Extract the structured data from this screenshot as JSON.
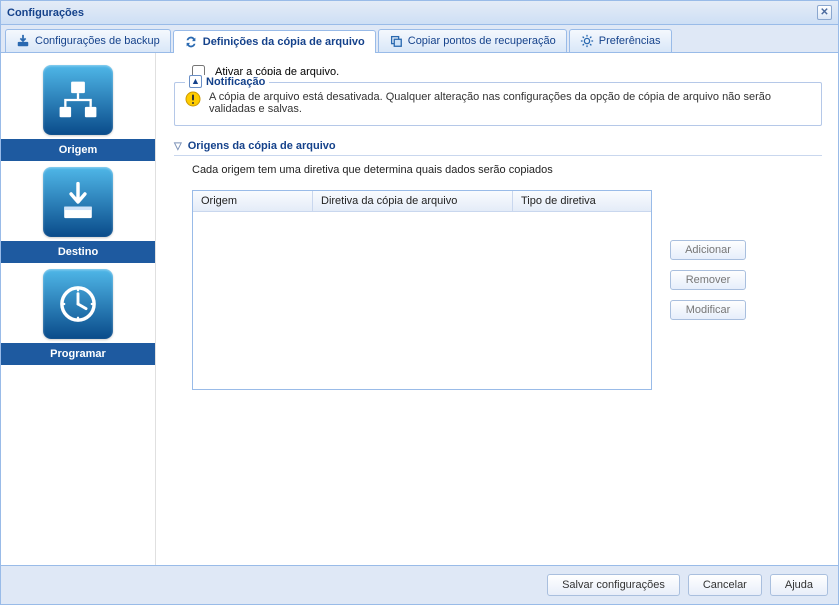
{
  "window": {
    "title": "Configurações"
  },
  "tabs": [
    {
      "label": "Configurações de backup"
    },
    {
      "label": "Definições da cópia de arquivo"
    },
    {
      "label": "Copiar pontos de recuperação"
    },
    {
      "label": "Preferências"
    }
  ],
  "sidebar": {
    "items": [
      {
        "label": "Origem"
      },
      {
        "label": "Destino"
      },
      {
        "label": "Programar"
      }
    ]
  },
  "main": {
    "enable_label": "Ativar a cópia de arquivo.",
    "notification": {
      "legend": "Notificação",
      "text": "A cópia de arquivo está desativada. Qualquer alteração nas configurações da opção de cópia de arquivo não serão validadas e salvas."
    },
    "section_title": "Origens da cópia de arquivo",
    "section_desc": "Cada origem tem uma diretiva que determina quais dados serão copiados",
    "table": {
      "columns": [
        "Origem",
        "Diretiva da cópia de arquivo",
        "Tipo de diretiva"
      ]
    },
    "buttons": {
      "add": "Adicionar",
      "remove": "Remover",
      "modify": "Modificar"
    }
  },
  "footer": {
    "save": "Salvar configurações",
    "cancel": "Cancelar",
    "help": "Ajuda"
  }
}
